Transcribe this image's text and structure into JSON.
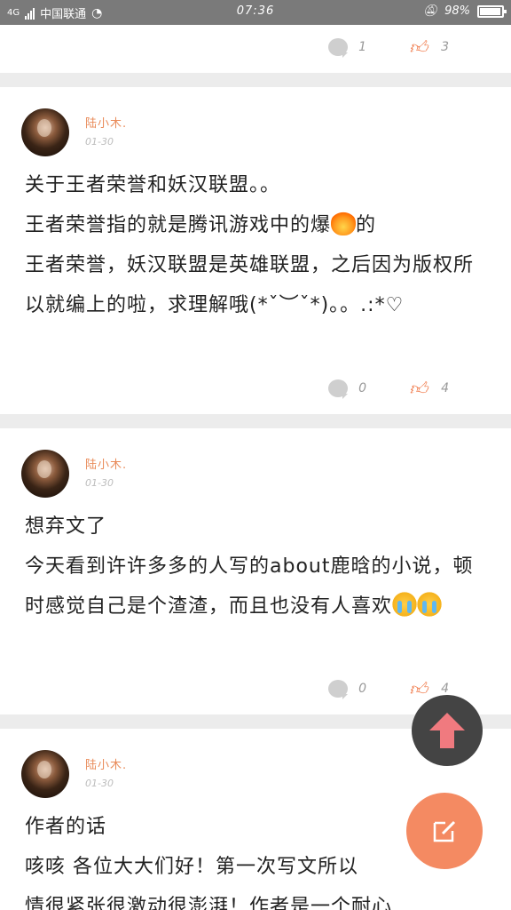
{
  "status_bar": {
    "network": "4G",
    "carrier": "中国联通",
    "time": "07:36",
    "battery": "98%"
  },
  "posts": [
    {
      "comments": "1",
      "likes": "3"
    },
    {
      "author": "陆小木.",
      "date": "01-30",
      "lines": [
        "关于王者荣誉和妖汉联盟。。",
        "王者荣誉指的就是腾讯游戏中的爆",
        "的",
        "王者荣誉，妖汉联盟是英雄联盟，之后因为版权所以就编上的啦，求理解哦(*ˇ︶ˇ*)。。.:*♡"
      ],
      "comments": "0",
      "likes": "4"
    },
    {
      "author": "陆小木.",
      "date": "01-30",
      "lines": [
        "想弃文了",
        "今天看到许许多多的人写的about鹿晗的小说，顿时感觉自己是个渣渣，而且也没有人喜欢"
      ],
      "comments": "0",
      "likes": "4"
    },
    {
      "author": "陆小木.",
      "date": "01-30",
      "lines": [
        "作者的话",
        "咳咳 各位大大们好！第一次写文所以",
        "情很紧张很激动很澎湃！作者是一个耐心"
      ]
    }
  ],
  "icons": {
    "comment": "comment-icon",
    "like": "thumbs-up-icon",
    "scroll_top": "arrow-up-icon",
    "compose": "edit-icon"
  },
  "colors": {
    "accent": "#f48a62",
    "author": "#e98b5a",
    "like": "#f07a4a"
  }
}
